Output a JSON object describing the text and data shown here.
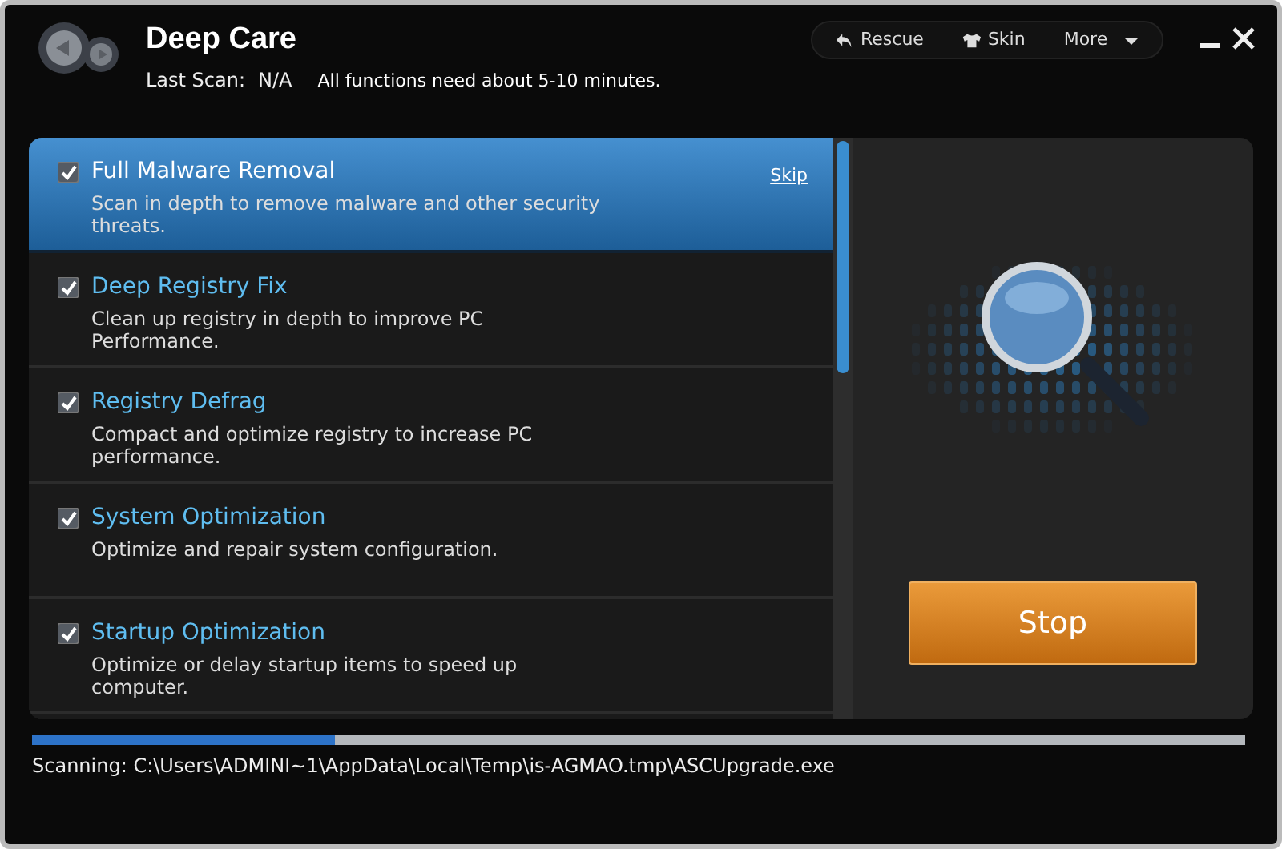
{
  "window": {
    "title": "Deep Care",
    "last_scan_label": "Last Scan:",
    "last_scan_value": "N/A",
    "note": "All functions need about 5-10 minutes."
  },
  "toolbar": [
    {
      "kind": "rescue",
      "label": "Rescue"
    },
    {
      "kind": "skin",
      "label": "Skin"
    },
    {
      "kind": "more",
      "label": "More"
    }
  ],
  "tasks": [
    {
      "title": "Full Malware Removal",
      "description": "Scan in depth to remove malware and other security threats.",
      "checked": true,
      "selected": true,
      "action": "Skip"
    },
    {
      "title": "Deep Registry Fix",
      "description": "Clean up registry in depth to improve PC Performance.",
      "checked": true,
      "selected": false
    },
    {
      "title": "Registry Defrag",
      "description": "Compact and optimize registry to increase PC performance.",
      "checked": true,
      "selected": false
    },
    {
      "title": "System Optimization",
      "description": "Optimize and repair system configuration.",
      "checked": true,
      "selected": false
    },
    {
      "title": "Startup Optimization",
      "description": "Optimize or delay startup items to speed up computer.",
      "checked": true,
      "selected": false
    }
  ],
  "stop_button": "Stop",
  "progress": {
    "level": 0.25
  },
  "status": "Scanning: C:\\Users\\ADMINI~1\\AppData\\Local\\Temp\\is-AGMAO.tmp\\ASCUpgrade.exe"
}
